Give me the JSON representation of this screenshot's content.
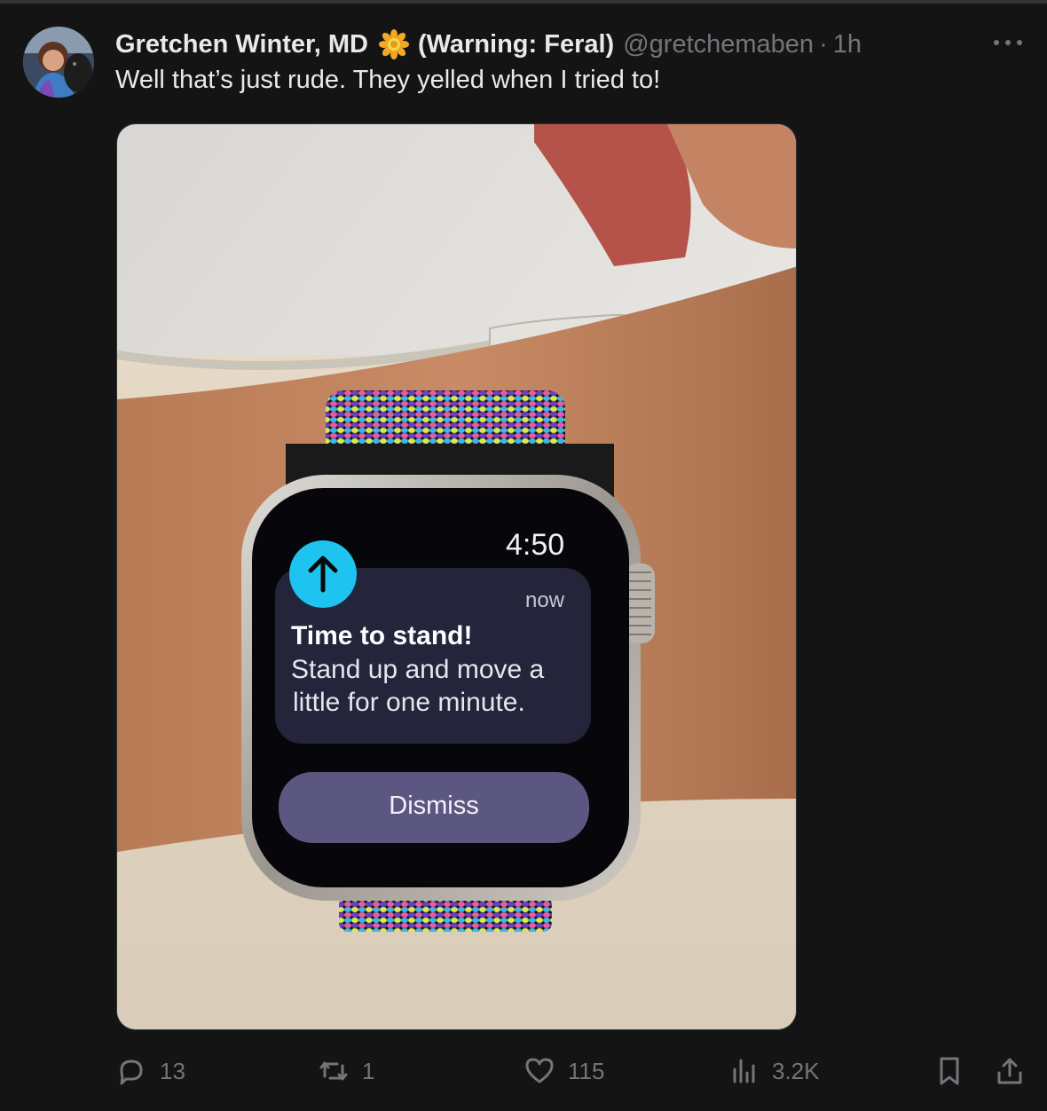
{
  "tweet": {
    "display_name": "Gretchen Winter, MD",
    "name_suffix": "(Warning: Feral)",
    "name_emoji": "sunflower-icon",
    "handle": "@gretchemaben",
    "separator": "·",
    "time": "1h",
    "text": "Well that’s just rude. They yelled when I tried to!"
  },
  "media": {
    "watch_time": "4:50",
    "notification_age": "now",
    "notification_title": "Time to stand!",
    "notification_line1": "Stand up and move a",
    "notification_line2": "little for one minute.",
    "dismiss_label": "Dismiss"
  },
  "actions": {
    "replies": "13",
    "reposts": "1",
    "likes": "115",
    "views": "3.2K"
  },
  "colors": {
    "background": "#141414",
    "text": "#e7e9ea",
    "muted": "#71767b",
    "stand_icon": "#1fc3f0",
    "dismiss_button": "#5b5780"
  }
}
